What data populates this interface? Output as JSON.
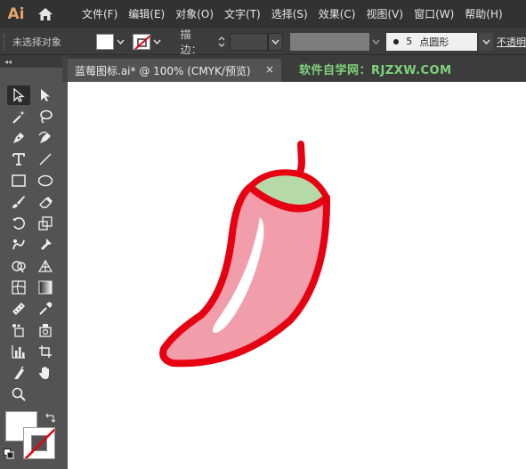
{
  "app": {
    "logo": "Ai"
  },
  "menu": [
    "文件(F)",
    "编辑(E)",
    "对象(O)",
    "文字(T)",
    "选择(S)",
    "效果(C)",
    "视图(V)",
    "窗口(W)",
    "帮助(H)"
  ],
  "control": {
    "selection_status": "未选择对象",
    "stroke_label": "描边：",
    "brush_size": "5",
    "brush_shape": "点圆形",
    "opacity_label": "不透明"
  },
  "document": {
    "tab_title": "蓝莓图标.ai* @ 100% (CMYK/预览)",
    "close_glyph": "×"
  },
  "watermark": "软件自学网：RJZXW.COM",
  "toolpanel": {
    "collapse_glyph": "◂◂"
  },
  "colors": {
    "pepper_fill": "#f29eaa",
    "pepper_stroke": "#e60012",
    "stem_fill": "#b6d9a8",
    "highlight": "#ffffff",
    "menubar_bg": "#323232",
    "watermark": "#7fd37a"
  },
  "icons": [
    "home-icon",
    "selection-tool-icon",
    "direct-selection-tool-icon",
    "magic-wand-icon",
    "lasso-icon",
    "pen-icon",
    "curvature-icon",
    "type-icon",
    "line-icon",
    "rectangle-icon",
    "ellipse-icon",
    "paintbrush-icon",
    "eraser-icon",
    "rotate-icon",
    "scale-icon",
    "warp-icon",
    "puppet-warp-icon",
    "shape-builder-icon",
    "perspective-grid-icon",
    "mesh-icon",
    "gradient-icon",
    "eyedropper-icon",
    "measure-icon",
    "symbol-sprayer-icon",
    "column-graph-icon",
    "artboard-icon",
    "slice-icon",
    "hand-icon",
    "zoom-icon",
    "swap-colors-icon",
    "default-colors-icon"
  ]
}
